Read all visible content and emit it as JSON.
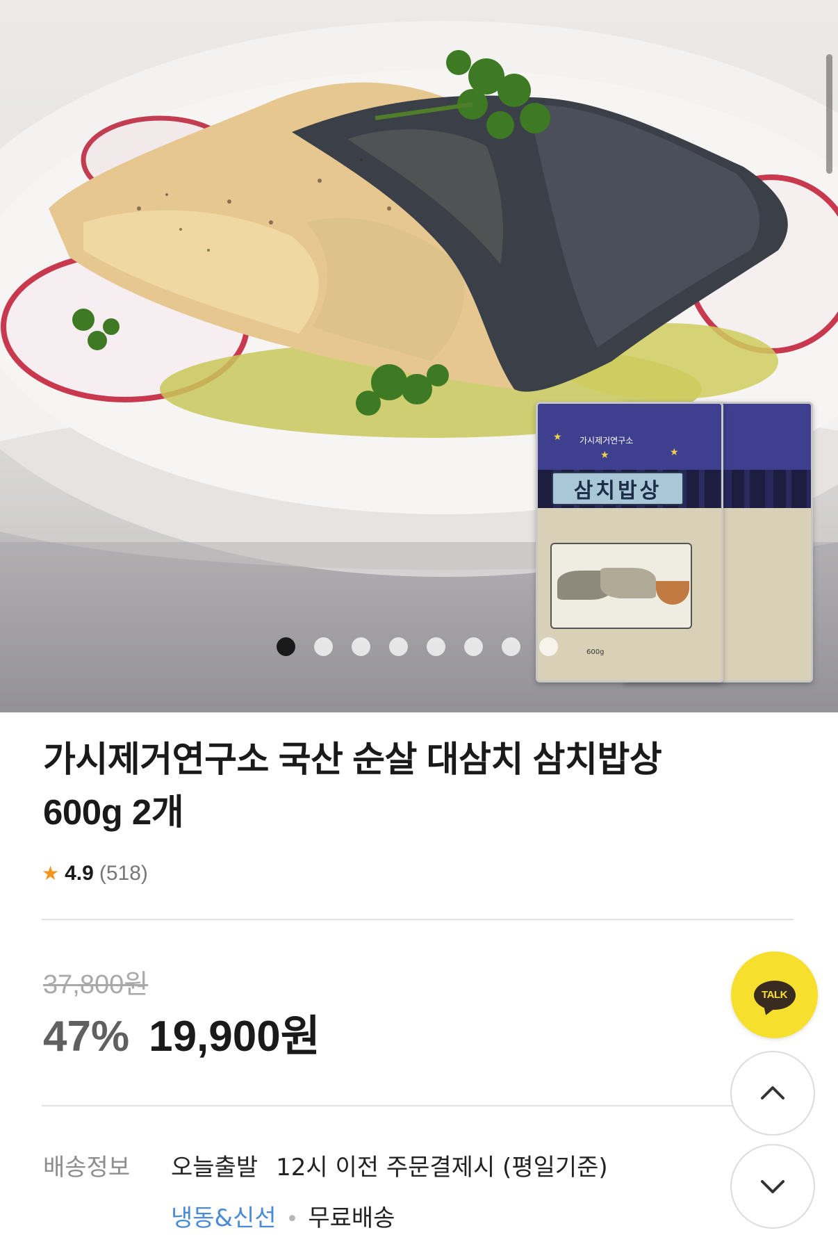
{
  "hero": {
    "carousel": {
      "total": 8,
      "active": 1
    },
    "pack": {
      "brand": "가시제거연구소",
      "name": "삼치밥상",
      "weight": "600g"
    }
  },
  "product": {
    "title": "가시제거연구소 국산 순살 대삼치 삼치밥상 600g 2개",
    "rating": {
      "score": "4.9",
      "count": "(518)"
    },
    "original_price": "37,800원",
    "discount": "47%",
    "sale_price": "19,900원"
  },
  "shipping": {
    "label": "배송정보",
    "dispatch": "오늘출발",
    "condition": "12시 이전 주문결제시 (평일기준)",
    "tag_frozen": "냉동&신선",
    "separator": "•",
    "tag_free": "무료배송"
  },
  "floating": {
    "talk_label": "TALK",
    "up_icon": "chevron-up-icon",
    "down_icon": "chevron-down-icon"
  },
  "colors": {
    "accent_talk": "#f6df2d",
    "star": "#f7941d",
    "frozen_tag": "#4b8ad6"
  }
}
